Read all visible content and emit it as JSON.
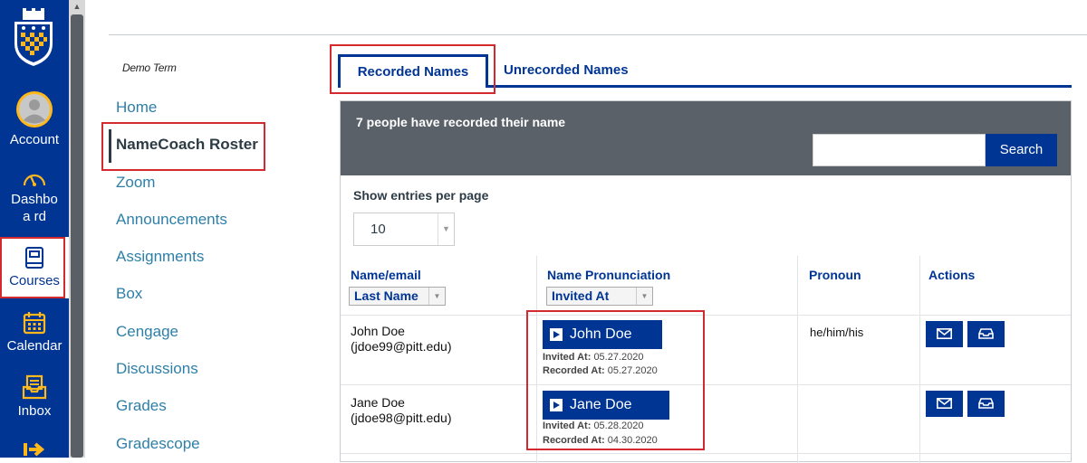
{
  "global_nav": {
    "items": [
      {
        "label": "Account",
        "icon": "account-icon"
      },
      {
        "label": "Dashboa rd",
        "icon": "dashboard-icon"
      },
      {
        "label": "Courses",
        "icon": "courses-icon"
      },
      {
        "label": "Calendar",
        "icon": "calendar-icon"
      },
      {
        "label": "Inbox",
        "icon": "inbox-icon"
      }
    ]
  },
  "course_nav": {
    "term": "Demo Term",
    "items": [
      "Home",
      "NameCoach Roster",
      "Zoom",
      "Announcements",
      "Assignments",
      "Box",
      "Cengage",
      "Discussions",
      "Grades",
      "Gradescope"
    ]
  },
  "tabs": {
    "recorded": "Recorded Names",
    "unrecorded": "Unrecorded Names"
  },
  "roster": {
    "count_text": "7 people have recorded their name",
    "search_label": "Search",
    "search_value": "",
    "entries_label": "Show entries per page",
    "entries_value": "10",
    "columns": {
      "name": "Name/email",
      "pronunciation": "Name Pronunciation",
      "pronoun": "Pronoun",
      "actions": "Actions"
    },
    "sort_name": "Last Name",
    "sort_pronunciation": "Invited At",
    "rows": [
      {
        "name": "John Doe",
        "email": "(jdoe99@pitt.edu)",
        "play_label": "John Doe",
        "invited_label": "Invited At:",
        "invited": "05.27.2020",
        "recorded_label": "Recorded At:",
        "recorded": "05.27.2020",
        "pronoun": "he/him/his"
      },
      {
        "name": "Jane Doe",
        "email": "(jdoe98@pitt.edu)",
        "play_label": "Jane Doe",
        "invited_label": "Invited At:",
        "invited": "05.28.2020",
        "recorded_label": "Recorded At:",
        "recorded": "04.30.2020",
        "pronoun": ""
      }
    ]
  },
  "colors": {
    "brand": "#003594",
    "accent": "#FFB81C",
    "highlight": "#d42a2f",
    "link": "#2d7fa8"
  }
}
